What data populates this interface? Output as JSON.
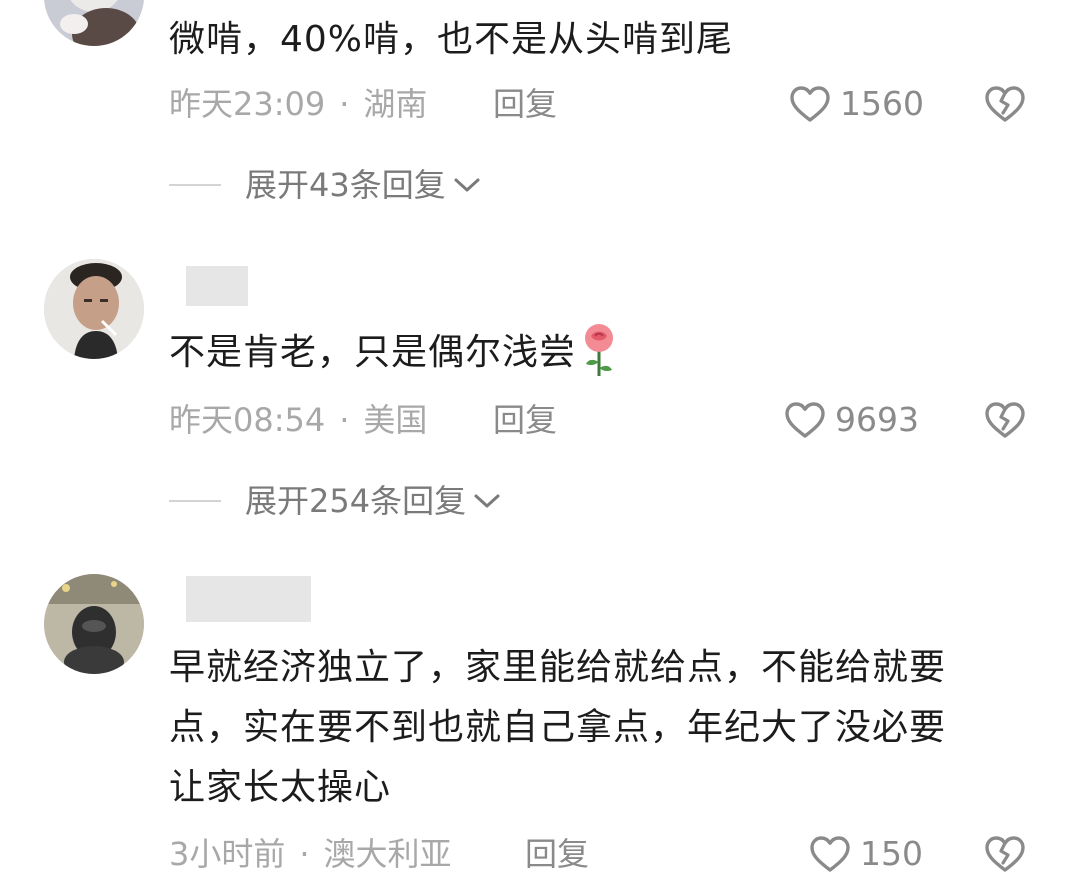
{
  "comments": [
    {
      "text_lines": [
        "微啃，40%啃，也不是从头啃到尾"
      ],
      "time": "昨天23:09",
      "region": "湖南",
      "reply_label": "回复",
      "like_count": "1560",
      "expand_label": "展开43条回复"
    },
    {
      "text_lines": [
        "不是肯老，只是偶尔浅尝"
      ],
      "emoji": "rose-emoji",
      "time": "昨天08:54",
      "region": "美国",
      "reply_label": "回复",
      "like_count": "9693",
      "expand_label": "展开254条回复"
    },
    {
      "text_lines": [
        "早就经济独立了，家里能给就给点，不能给就要",
        "点，实在要不到也就自己拿点，年纪大了没必要",
        "让家长太操心"
      ],
      "time": "3小时前",
      "region": "澳大利亚",
      "reply_label": "回复",
      "like_count": "150"
    }
  ],
  "separator": "·",
  "icons": {
    "like": "heart-outline-icon",
    "dislike": "broken-heart-icon",
    "expand": "chevron-down-icon"
  },
  "colors": {
    "text": "#1c1c1c",
    "meta": "#a8a8a8",
    "action": "#8a8a8a"
  }
}
